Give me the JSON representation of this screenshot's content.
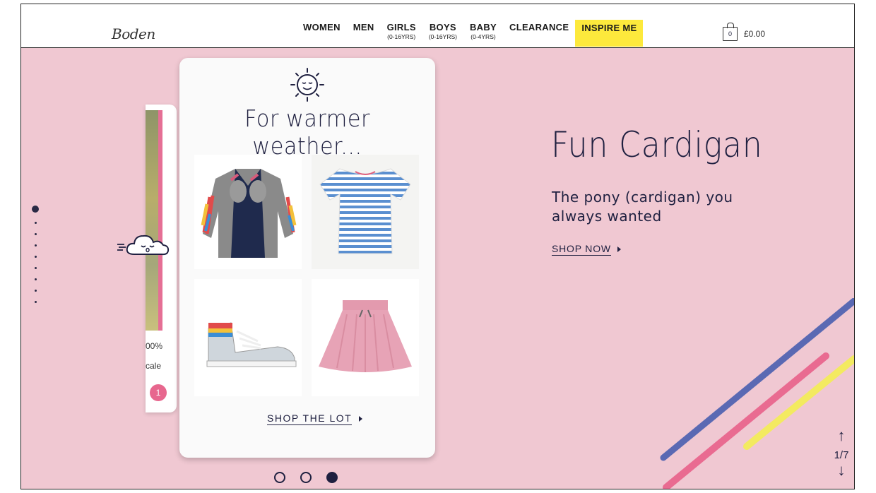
{
  "brand": {
    "logo_text": "Boden"
  },
  "nav": {
    "items": [
      {
        "label": "WOMEN",
        "sub": ""
      },
      {
        "label": "MEN",
        "sub": ""
      },
      {
        "label": "GIRLS",
        "sub": "(0-16YRS)"
      },
      {
        "label": "BOYS",
        "sub": "(0-16YRS)"
      },
      {
        "label": "BABY",
        "sub": "(0-4YRS)"
      },
      {
        "label": "CLEARANCE",
        "sub": ""
      },
      {
        "label": "INSPIRE ME",
        "sub": ""
      }
    ],
    "highlight_color": "#fde93c"
  },
  "basket": {
    "count": "0",
    "total": "£0.00"
  },
  "prev_card": {
    "text_1": "00%",
    "text_2": "cale",
    "badge": "1"
  },
  "card": {
    "title": "For warmer weather...",
    "cta": "SHOP THE LOT",
    "products": [
      {
        "name": "pony-cardigan"
      },
      {
        "name": "striped-tshirt"
      },
      {
        "name": "high-top-sneaker"
      },
      {
        "name": "pink-skirt"
      }
    ]
  },
  "hero": {
    "title": "Fun Cardigan",
    "subtitle": "The pony (cardigan) you always wanted",
    "cta": "SHOP NOW"
  },
  "pager": {
    "up_icon": "arrow-up-icon",
    "count": "1/7",
    "down_icon": "arrow-down-icon"
  },
  "colors": {
    "background_pink": "#f0c8d2",
    "navy": "#1f2040",
    "accent_pink": "#e7678e"
  }
}
